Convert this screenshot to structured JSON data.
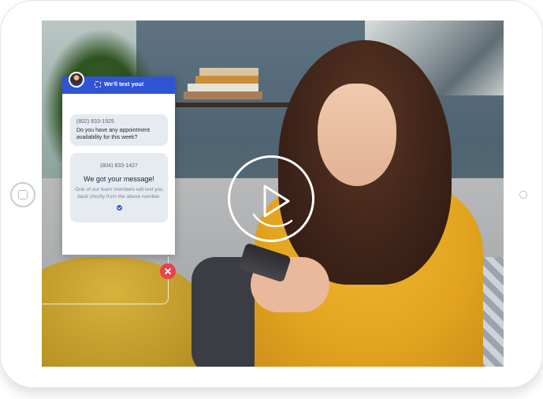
{
  "chat": {
    "title": "We'll text you!",
    "incoming": {
      "phone": "(802) 833-1925",
      "text": "Do you have any appointment availability for this week?"
    },
    "confirmation": {
      "phone": "(804) 833-1427",
      "title": "We got your message!",
      "text": "One of our team members will text you back shortly from the above number."
    }
  },
  "colors": {
    "header": "#2f55d4",
    "bubble": "#e6ebf2",
    "close": "#e8434a",
    "sweater": "#e3a41f"
  },
  "icons": {
    "play": "play-icon",
    "close": "close-icon",
    "check": "check-icon",
    "home": "home-button-icon"
  }
}
